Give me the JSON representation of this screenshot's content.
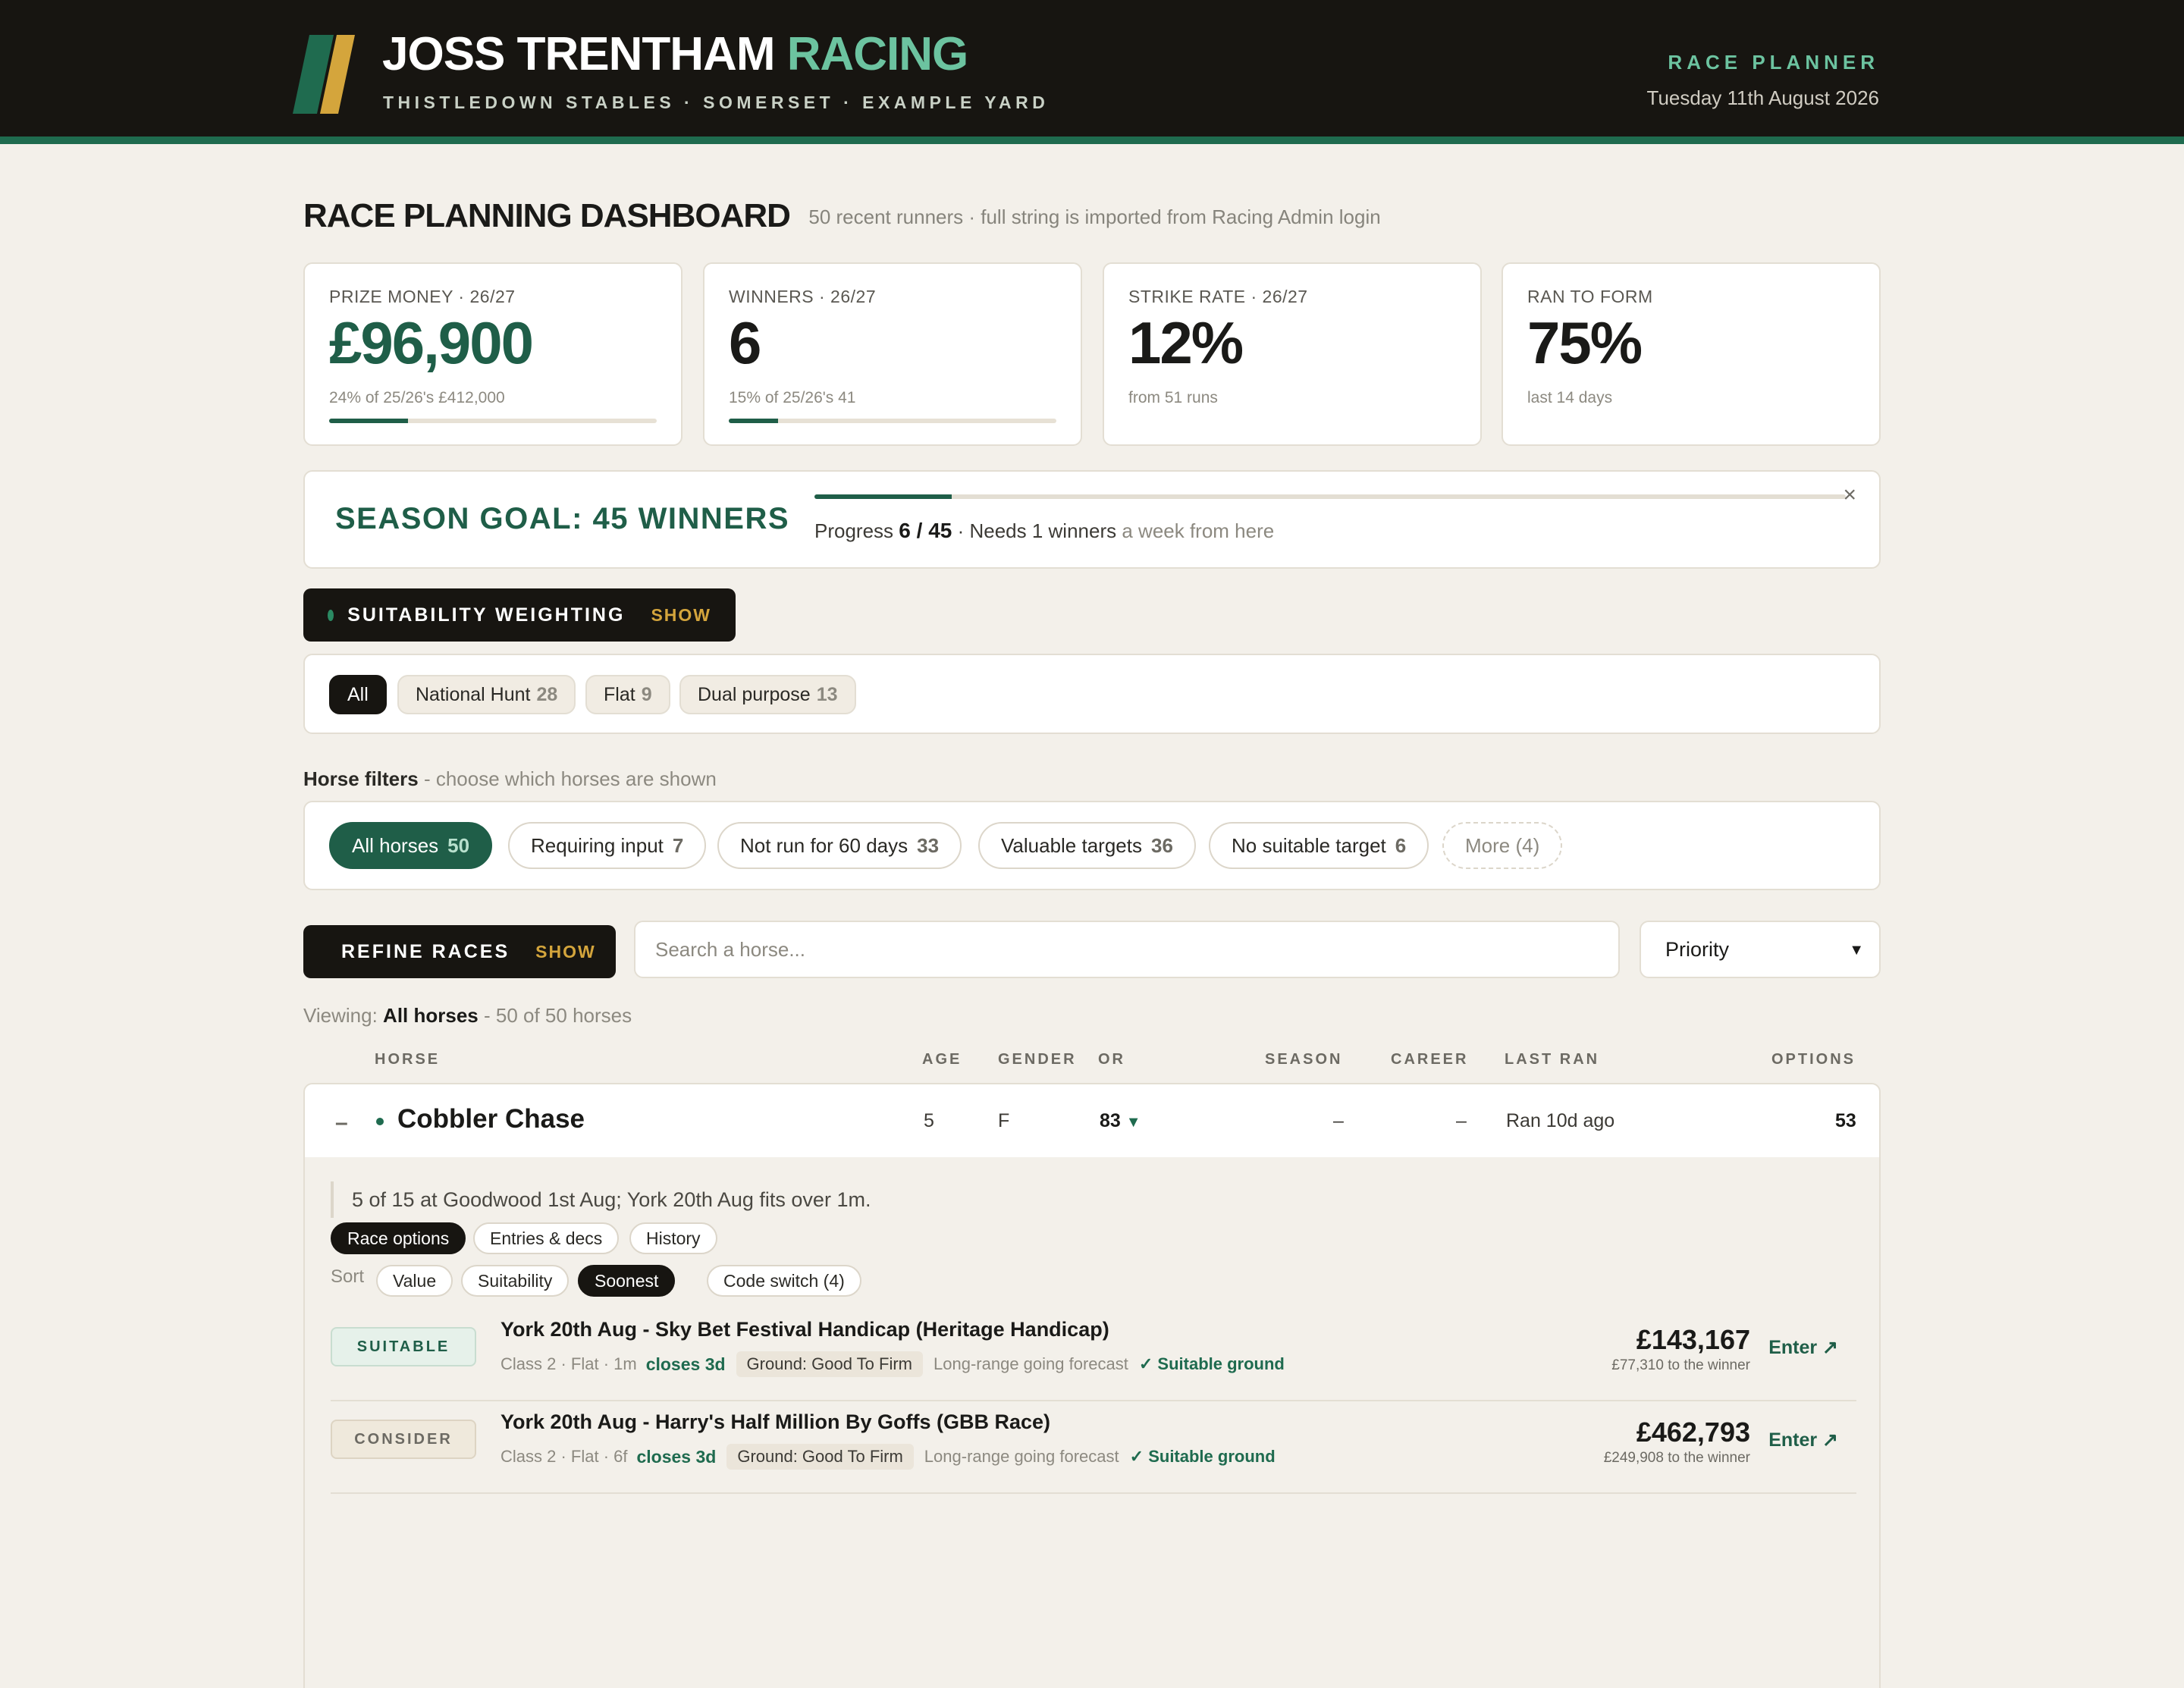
{
  "header": {
    "brand_main": "JOSS TRENTHAM",
    "brand_accent": "RACING",
    "subtitle": "THISTLEDOWN STABLES · SOMERSET · EXAMPLE YARD",
    "section": "RACE PLANNER",
    "date": "Tuesday 11th August 2026",
    "colors": {
      "dark": "#171511",
      "accent": "#6cc3a0",
      "brand_green": "#1f5e48",
      "gold": "#d4a53c"
    }
  },
  "dashboard": {
    "title": "RACE PLANNING DASHBOARD",
    "subtitle": "50 recent runners · full string is imported from Racing Admin login"
  },
  "stats": [
    {
      "label": "PRIZE MONEY · 26/27",
      "value": "£96,900",
      "note": "24% of 25/26's £412,000",
      "progress": 0.24
    },
    {
      "label": "WINNERS · 26/27",
      "value": "6",
      "note": "15% of 25/26's 41",
      "progress": 0.15
    },
    {
      "label": "STRIKE RATE · 26/27",
      "value": "12%",
      "note": "from 51 runs"
    },
    {
      "label": "RAN TO FORM",
      "value": "75%",
      "note": "last 14 days"
    }
  ],
  "goal": {
    "title": "SEASON GOAL: 45 WINNERS",
    "progress_label": "Progress",
    "progress_value": "6 / 45",
    "progress_fraction": 0.133,
    "needs": "· Needs 1 winners",
    "needs_muted": "a week from here",
    "close_icon": "×"
  },
  "suitability": {
    "label": "SUITABILITY WEIGHTING",
    "toggle": "SHOW"
  },
  "codes": [
    {
      "label": "All",
      "count": "",
      "active": true
    },
    {
      "label": "National Hunt",
      "count": "28"
    },
    {
      "label": "Flat",
      "count": "9"
    },
    {
      "label": "Dual purpose",
      "count": "13"
    }
  ],
  "horse_filters": {
    "heading": "Horse filters",
    "hint": "- choose which horses are shown",
    "items": [
      {
        "label": "All horses",
        "count": "50",
        "active": true
      },
      {
        "label": "Requiring input",
        "count": "7"
      },
      {
        "label": "Not run for 60 days",
        "count": "33"
      },
      {
        "label": "Valuable targets",
        "count": "36"
      },
      {
        "label": "No suitable target",
        "count": "6"
      },
      {
        "label": "More (4)",
        "count": ""
      }
    ]
  },
  "refine": {
    "label": "REFINE RACES",
    "toggle": "SHOW"
  },
  "search": {
    "placeholder": "Search a horse..."
  },
  "sort_select": {
    "value": "Priority"
  },
  "viewing": {
    "prefix": "Viewing:",
    "filter": "All horses",
    "suffix": "- 50 of 50 horses"
  },
  "table": {
    "headers": {
      "horse": "HORSE",
      "age": "AGE",
      "gender": "GENDER",
      "or": "OR",
      "season": "SEASON",
      "career": "CAREER",
      "last_ran": "LAST RAN",
      "options": "OPTIONS"
    },
    "row": {
      "toggle": "–",
      "name": "Cobbler Chase",
      "age": "5",
      "gender": "F",
      "or": "83",
      "or_trend": "▼",
      "season": "–",
      "career": "–",
      "last_ran": "Ran 10d ago",
      "options": "53"
    }
  },
  "detail": {
    "note": "5 of 15 at Goodwood 1st Aug; York 20th Aug fits over 1m.",
    "tabs": [
      "Race options",
      "Entries & decs",
      "History"
    ],
    "sort_label": "Sort",
    "sort_options": [
      "Value",
      "Suitability",
      "Soonest"
    ],
    "code_switch": "Code switch (4)",
    "races": [
      {
        "tag": "SUITABLE",
        "title": "York 20th Aug - Sky Bet Festival Handicap (Heritage Handicap)",
        "meta": "Class 2 · Flat · 1m",
        "closes": "closes 3d",
        "ground": "Ground: Good To Firm",
        "forecast": "Long-range going forecast",
        "ok": "✓ Suitable ground",
        "prize": "£143,167",
        "prize_sub": "£77,310 to the winner",
        "enter": "Enter ↗"
      },
      {
        "tag": "CONSIDER",
        "title": "York 20th Aug - Harry's Half Million By Goffs (GBB Race)",
        "meta": "Class 2 · Flat · 6f",
        "closes": "closes 3d",
        "ground": "Ground: Good To Firm",
        "forecast": "Long-range going forecast",
        "ok": "✓ Suitable ground",
        "prize": "£462,793",
        "prize_sub": "£249,908 to the winner",
        "enter": "Enter ↗"
      }
    ]
  }
}
